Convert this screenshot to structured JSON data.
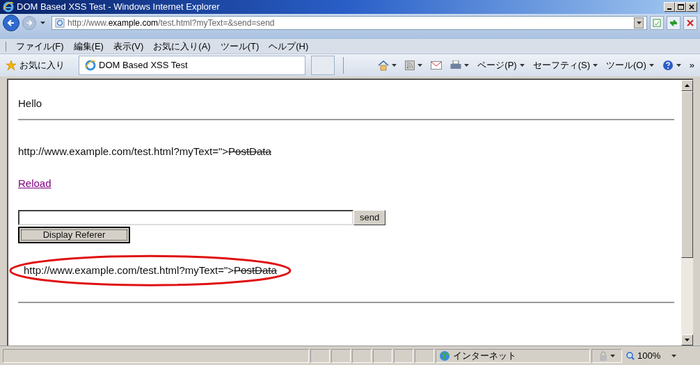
{
  "window": {
    "title": "DOM Based XSS Test - Windows Internet Explorer"
  },
  "address_bar": {
    "url_prefix": "http://www.",
    "url_domain": "example.com",
    "url_rest": "/test.html?myText=&send=send"
  },
  "menu": [
    "ファイル(F)",
    "編集(E)",
    "表示(V)",
    "お気に入り(A)",
    "ツール(T)",
    "ヘルプ(H)"
  ],
  "favorites_bar": {
    "favorites": "お気に入り",
    "tab": "DOM Based XSS Test",
    "commands": [
      "ページ(P)",
      "セーフティ(S)",
      "ツール(O)"
    ],
    "more": "»"
  },
  "page": {
    "heading": "Hello",
    "output_1": [
      {
        "text": "http://www.example.com/test.html?myText=\">",
        "struck": false
      },
      {
        "text": "PostData",
        "struck": true
      }
    ],
    "link": "Reload",
    "send_button": "send",
    "referer_button": "Display Referer",
    "output_2": [
      {
        "text": "http://www.example.com/test.html?myText=\">",
        "struck": false
      },
      {
        "text": "PostData",
        "struck": true
      }
    ],
    "output_2_circled": true
  },
  "status_bar": {
    "zone": "インターネット",
    "zoom": "100%"
  }
}
